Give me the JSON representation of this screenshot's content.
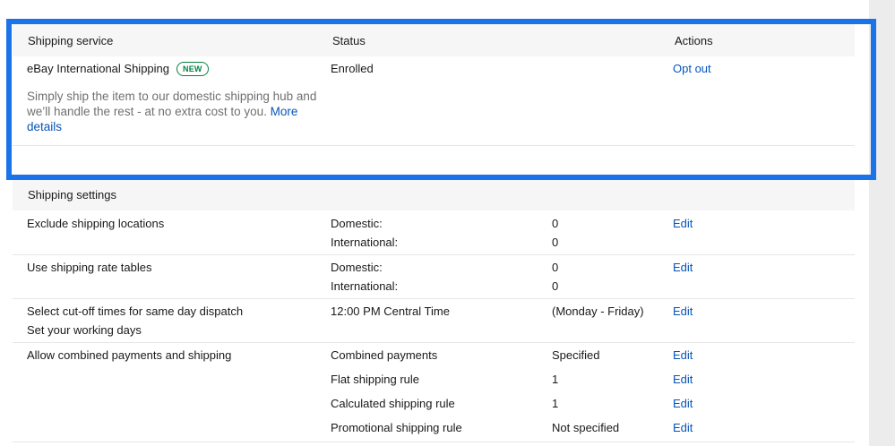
{
  "enrollment": {
    "headers": {
      "service": "Shipping service",
      "status": "Status",
      "actions": "Actions"
    },
    "service_name": "eBay International Shipping",
    "badge": "NEW",
    "status": "Enrolled",
    "action": "Opt out",
    "description": "Simply ship the item to our domestic shipping hub and we’ll handle the rest - at no extra cost to you.",
    "more_link": "More details"
  },
  "settings": {
    "header": "Shipping settings",
    "edit_label": "Edit",
    "rows": [
      {
        "label": "Exclude shipping locations",
        "sub": [
          {
            "name": "Domestic:",
            "value": "0"
          },
          {
            "name": "International:",
            "value": "0"
          }
        ]
      },
      {
        "label": "Use shipping rate tables",
        "sub": [
          {
            "name": "Domestic:",
            "value": "0"
          },
          {
            "name": "International:",
            "value": "0"
          }
        ]
      },
      {
        "label": "Select cut-off times for same day dispatch",
        "label2": "Set your working days",
        "sub": [
          {
            "name": "12:00 PM Central Time",
            "value": "(Monday - Friday)"
          }
        ]
      },
      {
        "label": "Allow combined payments and shipping",
        "sub": [
          {
            "name": "Combined payments",
            "value": "Specified"
          },
          {
            "name": "Flat shipping rule",
            "value": "1"
          },
          {
            "name": "Calculated shipping rule",
            "value": "1"
          },
          {
            "name": "Promotional shipping rule",
            "value": "Not specified"
          }
        ]
      }
    ]
  },
  "colors": {
    "link": "#0654ba",
    "highlight": "#1a73e8",
    "badge": "#05823f"
  }
}
